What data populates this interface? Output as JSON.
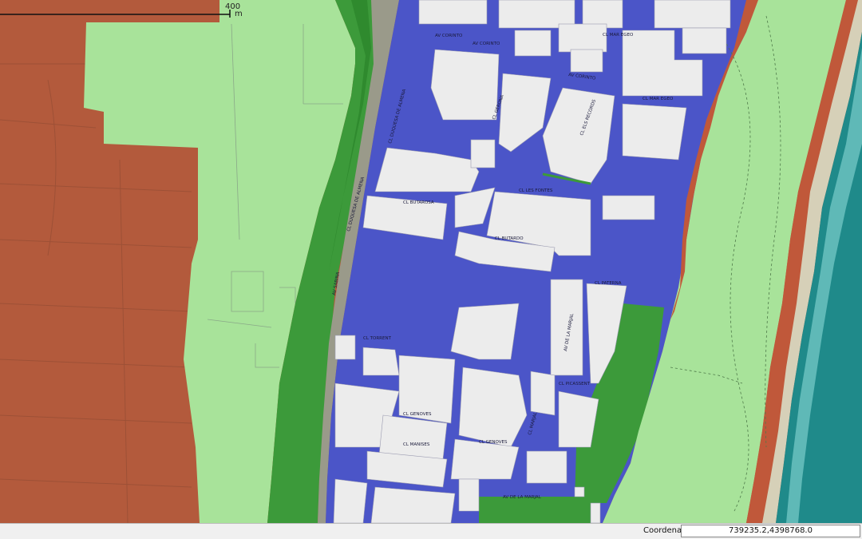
{
  "map": {
    "scale": {
      "value": "400",
      "unit": "m"
    },
    "layer_colors": {
      "agricultural": "#b35a3c",
      "buffer_light": "#a8e39a",
      "green_zone": "#3c9a3a",
      "green_dark": "#2f8a2e",
      "urban": "#4b55c8",
      "buildings": "#ececec",
      "sea_deep": "#1f8a8a",
      "sea_shallow": "#6fc4c2",
      "beach": "#d6d0b8",
      "coast_red": "#c0583a"
    },
    "street_labels": [
      "AV CORINTO",
      "AV CORINTO",
      "AV CORINTO",
      "CL MAR EGEO",
      "CL MAR EGEO",
      "CL DUQUESA DE ALMENA",
      "CL DUQUESA DE ALMENA",
      "CL GERONA",
      "CL ELS RECORDS",
      "CL LES FONTES",
      "CL BUTAROSA",
      "CL BUTARDO",
      "AV SABINA",
      "CL PATERNA",
      "CL TORRENT",
      "CL PICASSENT",
      "AV DE LA MARJAL",
      "CL GENOVES",
      "CL GENOVES",
      "CL MANISES",
      "AV DE LA MARJAL",
      "CL MARJAL"
    ]
  },
  "statusbar": {
    "coord_label": "Coordenada",
    "coord_value": "739235.2,4398768.0"
  }
}
